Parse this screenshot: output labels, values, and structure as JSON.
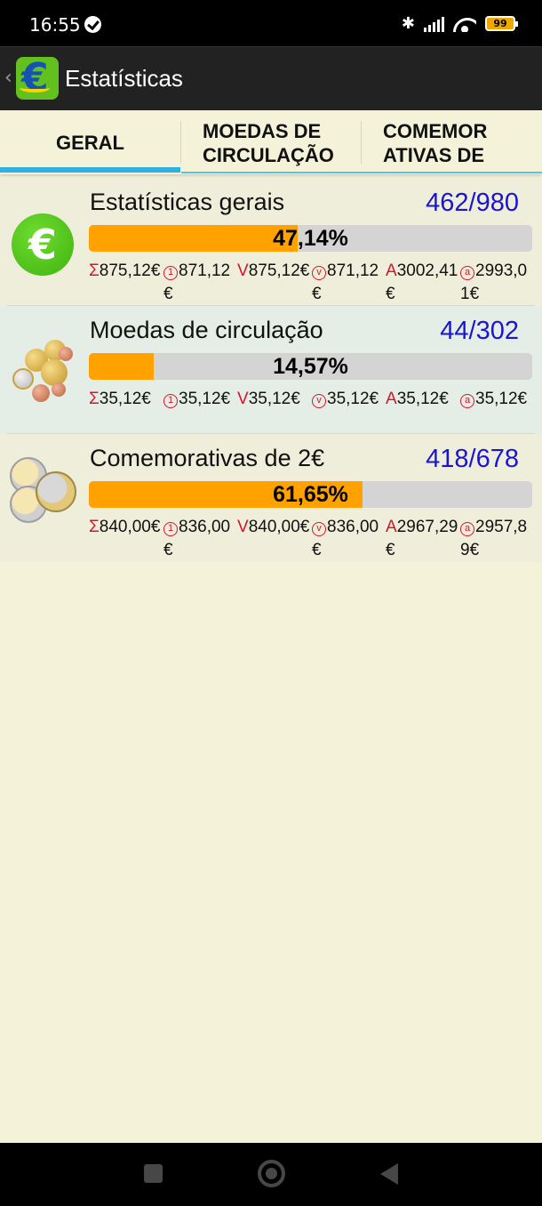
{
  "status_bar": {
    "time": "16:55",
    "battery": "99"
  },
  "app_bar": {
    "title": "Estatísticas",
    "logo_symbol": "€"
  },
  "tabs": [
    {
      "label": "GERAL",
      "selected": true
    },
    {
      "label": "MOEDAS DE CIRCULAÇÃO",
      "selected": false
    },
    {
      "label": "COMEMOR ATIVAS DE",
      "selected": false
    }
  ],
  "stats": [
    {
      "icon": "euro-icon",
      "title": "Estatísticas gerais",
      "count": "462/980",
      "percent_label": "47,14%",
      "progress": 0.4714,
      "values": [
        {
          "symbol": "Σ",
          "value": "875,12€"
        },
        {
          "symbol": "①",
          "value": "871,12€"
        },
        {
          "symbol": "V",
          "value": "875,12€"
        },
        {
          "symbol": "ⓥ",
          "value": "871,12€"
        },
        {
          "symbol": "A",
          "value": "3002,41€"
        },
        {
          "symbol": "ⓐ",
          "value": "2993,01€"
        }
      ]
    },
    {
      "icon": "coin-set-icon",
      "title": "Moedas de circulação",
      "count": "44/302",
      "percent_label": "14,57%",
      "progress": 0.1457,
      "values": [
        {
          "symbol": "Σ",
          "value": "35,12€"
        },
        {
          "symbol": "①",
          "value": "35,12€"
        },
        {
          "symbol": "V",
          "value": "35,12€"
        },
        {
          "symbol": "ⓥ",
          "value": "35,12€"
        },
        {
          "symbol": "A",
          "value": "35,12€"
        },
        {
          "symbol": "ⓐ",
          "value": "35,12€"
        }
      ]
    },
    {
      "icon": "two-euro-coins-icon",
      "title": "Comemorativas de 2€",
      "count": "418/678",
      "percent_label": "61,65%",
      "progress": 0.6165,
      "values": [
        {
          "symbol": "Σ",
          "value": "840,00€"
        },
        {
          "symbol": "①",
          "value": "836,00€"
        },
        {
          "symbol": "V",
          "value": "840,00€"
        },
        {
          "symbol": "ⓥ",
          "value": "836,00€"
        },
        {
          "symbol": "A",
          "value": "2967,29€"
        },
        {
          "symbol": "ⓐ",
          "value": "2957,89€"
        }
      ]
    }
  ],
  "colors": {
    "accent": "#2fb0e0",
    "progress_fill": "#ffa200",
    "count": "#1a14d6",
    "symbol": "#d3152b"
  }
}
